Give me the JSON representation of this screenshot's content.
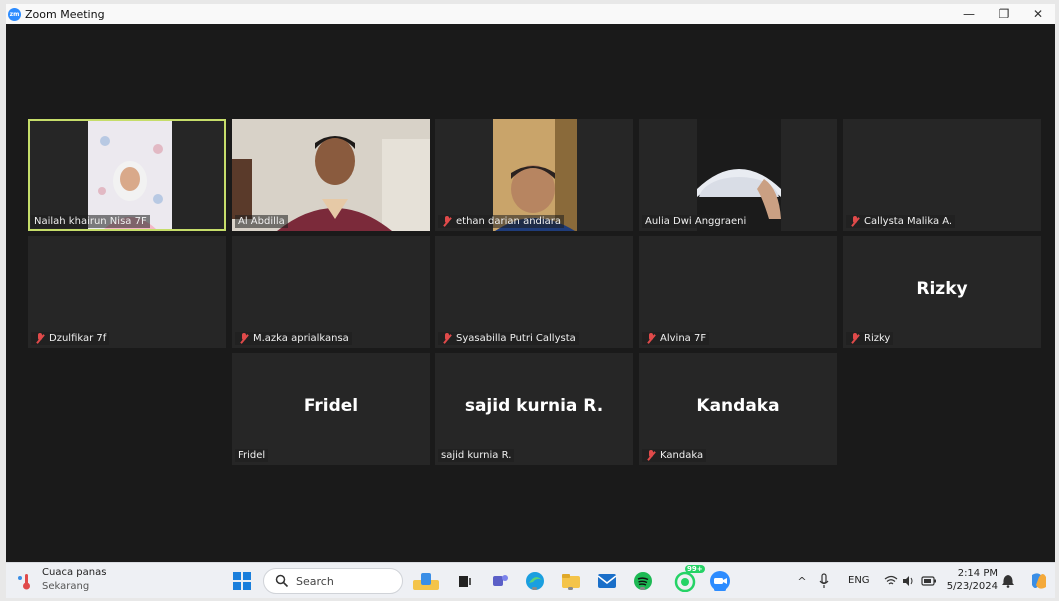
{
  "window": {
    "title": "Zoom Meeting",
    "logo_text": "zm",
    "minimize": "—",
    "restore": "❐",
    "close": "✕"
  },
  "participants": [
    {
      "name": "Nailah khairun Nisa 7F",
      "muted": false,
      "video": true,
      "active_speaker": true
    },
    {
      "name": "Al Abdilla",
      "muted": false,
      "video": true
    },
    {
      "name": "ethan darian andiara",
      "muted": true,
      "video": true
    },
    {
      "name": "Aulia Dwi Anggraeni",
      "muted": false,
      "video": true
    },
    {
      "name": "Callysta Malika A.",
      "muted": true,
      "video": false
    },
    {
      "name": "Dzulfikar 7f",
      "muted": true,
      "video": false
    },
    {
      "name": "M.azka aprialkansa",
      "muted": true,
      "video": false
    },
    {
      "name": "Syasabilla Putri Callysta",
      "muted": true,
      "video": false
    },
    {
      "name": "Alvina 7F",
      "muted": true,
      "video": false
    },
    {
      "name": "Rizky",
      "muted": true,
      "video": false,
      "display_name": "Rizky"
    },
    {
      "name": "Fridel",
      "muted": false,
      "video": false,
      "display_name": "Fridel"
    },
    {
      "name": "sajid kurnia R.",
      "muted": false,
      "video": false,
      "display_name": "sajid kurnia R."
    },
    {
      "name": "Kandaka",
      "muted": true,
      "video": false,
      "display_name": "Kandaka"
    }
  ],
  "taskbar": {
    "weather_title": "Cuaca panas",
    "weather_sub": "Sekarang",
    "search_placeholder": "Search",
    "notification_badge": "99+",
    "language": "ENG",
    "time": "2:14 PM",
    "date": "5/23/2024",
    "apps": [
      "start-icon",
      "search-box",
      "files-app-icon",
      "task-view-icon",
      "teams-icon",
      "edge-icon",
      "file-explorer-icon",
      "mail-icon",
      "spotify-icon",
      "whatsapp-icon",
      "zoom-icon"
    ],
    "accent_colors": {
      "zoom": "#2D8CFF",
      "spotify": "#1DB954",
      "whatsapp": "#25D366",
      "edge": "#1a9fe0",
      "teams": "#5b5fc7"
    }
  },
  "colors": {
    "stage_bg": "#1a1a1a",
    "tile_bg": "#262626",
    "active_border": "#c6dd6a",
    "muted_red": "#e04a4a"
  }
}
